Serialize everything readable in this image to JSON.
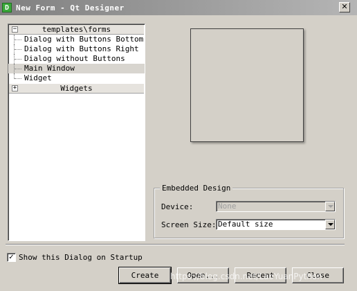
{
  "window": {
    "title": "New Form - Qt Designer",
    "app_icon_letter": "D",
    "close_glyph": "✕"
  },
  "templates": {
    "group_label": "templates\\forms",
    "group_expander": "−",
    "items": [
      {
        "label": "Dialog with Buttons Bottom",
        "selected": false
      },
      {
        "label": "Dialog with Buttons Right",
        "selected": false
      },
      {
        "label": "Dialog without Buttons",
        "selected": false
      },
      {
        "label": "Main Window",
        "selected": true
      },
      {
        "label": "Widget",
        "selected": false
      }
    ],
    "widgets_label": "Widgets",
    "widgets_expander": "+"
  },
  "embedded": {
    "title": "Embedded Design",
    "device_label": "Device:",
    "device_value": "None",
    "screen_size_label": "Screen Size:",
    "screen_size_value": "Default size"
  },
  "startup": {
    "checkbox_label": "Show this Dialog on Startup",
    "checked": true,
    "check_glyph": "✓"
  },
  "buttons": {
    "create": "Create",
    "open": "Open...",
    "recent": "Recent",
    "close": "Close"
  },
  "watermark": "https://blog.csdn.net/LaoYuanPython"
}
